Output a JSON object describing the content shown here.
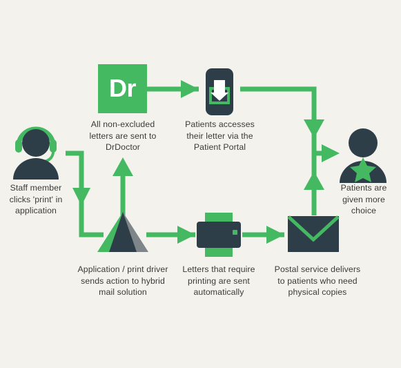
{
  "diagram": {
    "title": "Hybrid mail / DrDoctor patient letter flow",
    "background_color": "#f4f2ed",
    "accent_green": "#45b862",
    "dark_navy": "#2d3e48",
    "grey": "#7f868a",
    "text_color": "#3a3a38",
    "white": "#ffffff"
  },
  "nodes": {
    "staff_member": {
      "icon": "staff-headset-person-icon",
      "caption": "Staff member\nclicks 'print' in\napplication"
    },
    "hybrid_mail": {
      "icon": "pyramid-hybrid-mail-icon",
      "caption": "Application / print driver\nsends action to hybrid\nmail solution"
    },
    "drdoctor": {
      "icon": "drdoctor-logo-tile",
      "logo_text": "Dr",
      "caption": "All non-excluded\nletters are sent to\nDrDoctor"
    },
    "patient_portal": {
      "icon": "mobile-phone-letter-icon",
      "caption": "Patients accesses\ntheir letter via the\nPatient Portal"
    },
    "printer": {
      "icon": "printer-icon",
      "caption": "Letters that require\nprinting are sent\nautomatically"
    },
    "postal_service": {
      "icon": "envelope-icon",
      "caption": "Postal service delivers\nto patients who need\nphysical copies"
    },
    "patients_choice": {
      "icon": "patient-star-person-icon",
      "caption": "Patients are\ngiven more\nchoice"
    }
  },
  "connectors": [
    {
      "name": "staff-to-hybrid-mail",
      "from": "staff_member",
      "to": "hybrid_mail",
      "style": "elbow-down-right"
    },
    {
      "name": "hybrid-mail-to-drdoctor",
      "from": "hybrid_mail",
      "to": "drdoctor",
      "style": "up"
    },
    {
      "name": "drdoctor-to-patient-portal",
      "from": "drdoctor",
      "to": "patient_portal",
      "style": "right"
    },
    {
      "name": "patient-portal-to-junction",
      "from": "patient_portal",
      "to": "patients_choice",
      "style": "right-then-down"
    },
    {
      "name": "hybrid-mail-to-printer",
      "from": "hybrid_mail",
      "to": "printer",
      "style": "right"
    },
    {
      "name": "printer-to-postal-service",
      "from": "printer",
      "to": "postal_service",
      "style": "right"
    },
    {
      "name": "postal-service-to-junction",
      "from": "postal_service",
      "to": "patients_choice",
      "style": "up"
    },
    {
      "name": "junction-to-patients-choice",
      "from": "junction",
      "to": "patients_choice",
      "style": "right"
    }
  ]
}
